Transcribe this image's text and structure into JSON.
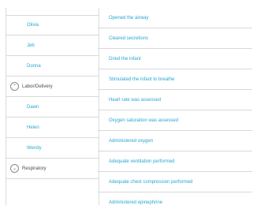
{
  "left_panel": {
    "rows": [
      {
        "label": "Olivia",
        "kind": "item"
      },
      {
        "label": "Jeb",
        "kind": "item"
      },
      {
        "label": "Donna",
        "kind": "item"
      },
      {
        "label": "Labor/Delivery",
        "kind": "group",
        "icon": "chevron-up-icon",
        "glyph": "⌃"
      },
      {
        "label": "Dawn",
        "kind": "item"
      },
      {
        "label": "Helen",
        "kind": "item"
      },
      {
        "label": "Wendy",
        "kind": "item"
      },
      {
        "label": "Respiratory",
        "kind": "group",
        "icon": "chevron-down-icon",
        "glyph": "⌄"
      }
    ]
  },
  "right_panel": {
    "actions": [
      "Opened the airway",
      "Cleared secretions",
      "Dried the infant",
      "Stimulated the infant to breathe",
      "Heart rate was assessed",
      "Oxygen saturation was assessed",
      "Administered oxygen",
      "Adequate ventilation performed",
      "Adequate chest compression performed",
      "Administered epinephrine"
    ]
  },
  "colors": {
    "link": "#2aa5d6",
    "group_text": "#4d4d4d",
    "divider": "#d9d9d9"
  }
}
